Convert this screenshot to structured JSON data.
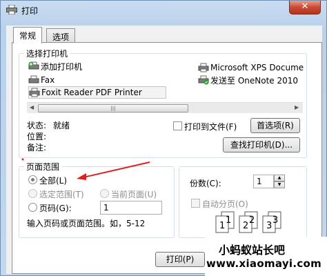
{
  "window": {
    "title": "打印",
    "close_label": "✕"
  },
  "tabs": [
    {
      "label": "常规"
    },
    {
      "label": "选项"
    }
  ],
  "printer_group": {
    "label": "选择打印机",
    "printers": [
      "添加打印机",
      "Microsoft XPS Docume",
      "Fax",
      "发送至 OneNote 2010",
      "Foxit Reader PDF Printer"
    ],
    "scroll_thumb": "|||"
  },
  "status": {
    "state_label": "状态:",
    "state_value": "就绪",
    "location_label": "位置:",
    "comment_label": "备注:"
  },
  "print_to_file_label": "打印到文件(F)",
  "preferences_button": "首选项(R)",
  "find_printer_button": "查找打印机(D)...",
  "page_range": {
    "label": "页面范围",
    "all_label": "全部(L)",
    "selection_label": "选定范围(T)",
    "current_page_label": "当前页面(U)",
    "pages_label": "页码(G):",
    "pages_value": "1",
    "hint": "输入页码或页面范围。如，5-12"
  },
  "copies": {
    "label": "份数(C):",
    "value": "1",
    "collate_label": "自动分页(O)",
    "page_numbers": [
      "1",
      "1",
      "2",
      "2",
      "3",
      "3"
    ]
  },
  "print_button": "打印(P)",
  "watermark": {
    "line1": "小蚂蚁站长吧",
    "line2": "www.xiaomayi.com"
  },
  "colors": {
    "annotation_arrow": "#e02020",
    "link_blue": "#1a5fb4"
  }
}
